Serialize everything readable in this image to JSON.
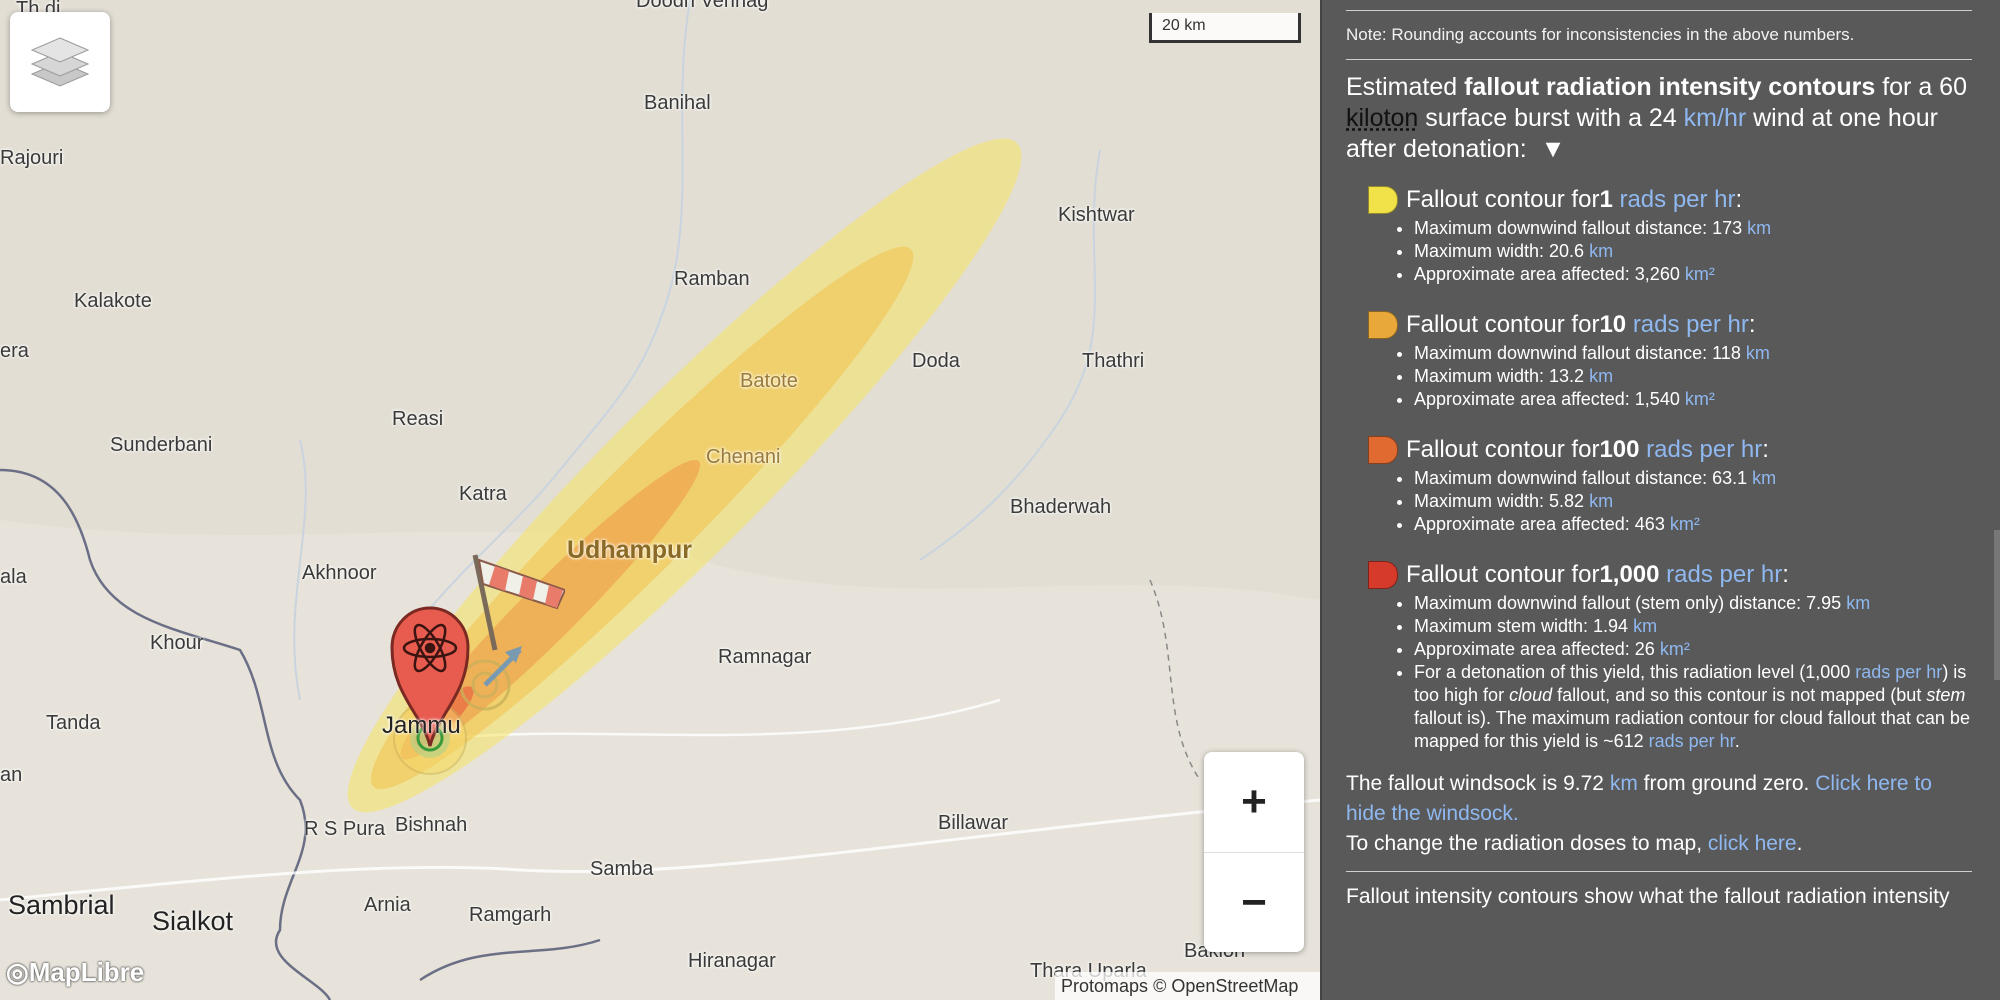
{
  "map": {
    "scale_label": "20 km",
    "zoom_in": "+",
    "zoom_out": "−",
    "maplibre": "MapLibre",
    "attribution_protomaps": "Protomaps",
    "attribution_osm": "© OpenStreetMap",
    "places": {
      "doda_verinag": "Doodh Verinag",
      "banihal": "Banihal",
      "rajouri": "Rajouri",
      "kishtwar": "Kishtwar",
      "ramban": "Ramban",
      "kalakote": "Kalakote",
      "era": "era",
      "batote": "Batote",
      "doda": "Doda",
      "thathri": "Thathri",
      "reasi": "Reasi",
      "sunderbani": "Sunderbani",
      "chenani": "Chenani",
      "katra": "Katra",
      "bhaderwah": "Bhaderwah",
      "udhampur": "Udhampur",
      "akhnoor": "Akhnoor",
      "ala": "ala",
      "khour": "Khour",
      "ramnagar": "Ramnagar",
      "jammu": "Jammu",
      "tanda": "Tanda",
      "an": "an",
      "rs_pura": "R S Pura",
      "bishnah": "Bishnah",
      "billawar": "Billawar",
      "samba": "Samba",
      "sambrial": "Sambrial",
      "sialkot": "Sialkot",
      "arnia": "Arnia",
      "ramgarh": "Ramgarh",
      "hiranagar": "Hiranagar",
      "thara_uparla": "Thara Uparla",
      "bakion": "Bakion",
      "top_left": "Th  di"
    },
    "colors": {
      "contour_1": "#f5e463",
      "contour_10": "#f2b84a",
      "contour_100": "#ee8a3c",
      "contour_1000": "#e74a3b"
    }
  },
  "panel": {
    "note": "Note: Rounding accounts for inconsistencies in the above numbers.",
    "intro": {
      "t1": "Estimated ",
      "b1": "fallout radiation intensity contours",
      "t2": " for a 60 ",
      "kiloton": "kiloton",
      "t3": " surface burst with a 24 ",
      "kmhr": "km/hr",
      "t4": " wind at one hour after detonation:",
      "arrow": "▼"
    },
    "contours": [
      {
        "color": "#f2e24a",
        "prefix": "Fallout contour for ",
        "value": "1",
        "unit": "rads per hr",
        "items": [
          {
            "text": "Maximum downwind fallout distance: 173 ",
            "unit": "km"
          },
          {
            "text": "Maximum width: 20.6 ",
            "unit": "km"
          },
          {
            "text": "Approximate area affected: 3,260 ",
            "unit": "km²"
          }
        ]
      },
      {
        "color": "#e8a83a",
        "prefix": "Fallout contour for ",
        "value": "10",
        "unit": "rads per hr",
        "items": [
          {
            "text": "Maximum downwind fallout distance: 118 ",
            "unit": "km"
          },
          {
            "text": "Maximum width: 13.2 ",
            "unit": "km"
          },
          {
            "text": "Approximate area affected: 1,540 ",
            "unit": "km²"
          }
        ]
      },
      {
        "color": "#e06a30",
        "prefix": "Fallout contour for ",
        "value": "100",
        "unit": "rads per hr",
        "items": [
          {
            "text": "Maximum downwind fallout distance: 63.1 ",
            "unit": "km"
          },
          {
            "text": "Maximum width: 5.82 ",
            "unit": "km"
          },
          {
            "text": "Approximate area affected: 463 ",
            "unit": "km²"
          }
        ]
      },
      {
        "color": "#d63a2a",
        "prefix": "Fallout contour for ",
        "value": "1,000",
        "unit": "rads per hr",
        "items": [
          {
            "text": "Maximum downwind fallout (stem only) distance: 7.95 ",
            "unit": "km"
          },
          {
            "text": "Maximum stem width: 1.94 ",
            "unit": "km"
          },
          {
            "text": "Approximate area affected: 26 ",
            "unit": "km²"
          }
        ],
        "extra": {
          "a": "For a detonation of this yield, this radiation level (1,000 ",
          "a_unit": "rads per hr",
          "b": ") is too high for ",
          "cloud": "cloud",
          "c": " fallout, and so this contour is not mapped (but ",
          "stem": "stem",
          "d": " fallout is). The maximum radiation contour for cloud fallout that can be mapped for this yield is ~612 ",
          "d_unit": "rads per hr",
          "e": "."
        }
      }
    ],
    "windsock": {
      "t1": "The fallout windsock is 9.72 ",
      "unit": "km",
      "t2": " from ground zero. ",
      "link": "Click here to hide the windsock."
    },
    "change": {
      "t1": "To change the radiation doses to map, ",
      "link": "click here",
      "t2": "."
    },
    "bottom": "Fallout intensity contours show what the fallout radiation intensity"
  }
}
